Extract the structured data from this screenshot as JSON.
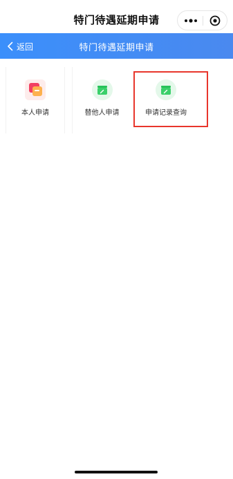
{
  "topbar": {
    "title": "特门待遇延期申请",
    "more_icon": "more-dots-icon",
    "close_icon": "close-circle-icon"
  },
  "navbar": {
    "back_label": "返回",
    "title": "特门待遇延期申请",
    "colors": {
      "gradient_start": "#3b8ffb",
      "gradient_end": "#4a89ef"
    }
  },
  "tiles": [
    {
      "label": "本人申请",
      "icon": "self-apply-icon"
    },
    {
      "label": "替他人申请",
      "icon": "proxy-apply-icon"
    },
    {
      "label": "申请记录查询",
      "icon": "record-query-icon"
    }
  ],
  "highlight": {
    "target": "申请记录查询",
    "color": "#e8352b"
  }
}
